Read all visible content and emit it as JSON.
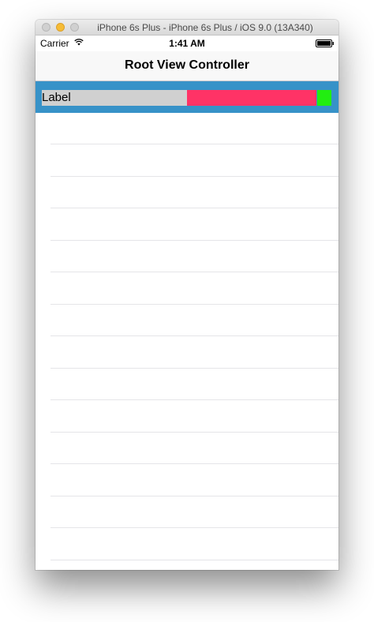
{
  "window": {
    "title": "iPhone 6s Plus - iPhone 6s Plus / iOS 9.0 (13A340)"
  },
  "status_bar": {
    "carrier": "Carrier",
    "time": "1:41 AM",
    "icons": [
      "wifi-icon",
      "battery-icon"
    ]
  },
  "nav": {
    "title": "Root View Controller"
  },
  "header": {
    "label": "Label",
    "colors": {
      "background": "#3792c8",
      "label_bg": "#d0d0d0",
      "pink": "#ff3366",
      "green": "#22ee11"
    }
  },
  "table": {
    "rows": 14
  }
}
